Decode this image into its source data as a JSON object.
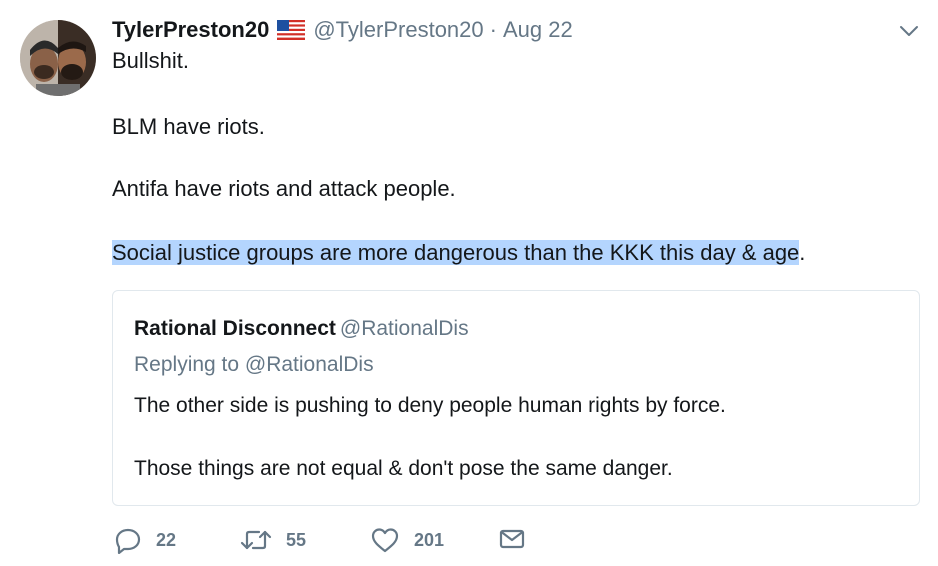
{
  "tweet": {
    "display_name": "TylerPreston20",
    "handle": "@TylerPreston20",
    "separator": "·",
    "time": "Aug 22",
    "paragraphs": [
      "Bullshit.",
      "BLM have riots.",
      "Antifa have riots and attack people."
    ],
    "highlighted_text": "Social justice groups are more dangerous than the KKK this day & age",
    "highlighted_tail": "."
  },
  "quoted": {
    "display_name": "Rational Disconnect",
    "handle": "@RationalDis",
    "replying_to": "Replying to @RationalDis",
    "text1": "The other side is pushing to deny people human rights by force.",
    "text2": "Those things are not equal & don't pose the same danger."
  },
  "actions": {
    "replies": "22",
    "retweets": "55",
    "likes": "201"
  },
  "icons": {
    "flag": "us-flag-icon",
    "caret": "chevron-down-icon",
    "reply": "reply-icon",
    "retweet": "retweet-icon",
    "like": "heart-icon",
    "dm": "envelope-icon"
  },
  "colors": {
    "text": "#14171a",
    "secondary": "#657786",
    "border": "#e1e8ed",
    "selection": "#b4d5fe"
  }
}
